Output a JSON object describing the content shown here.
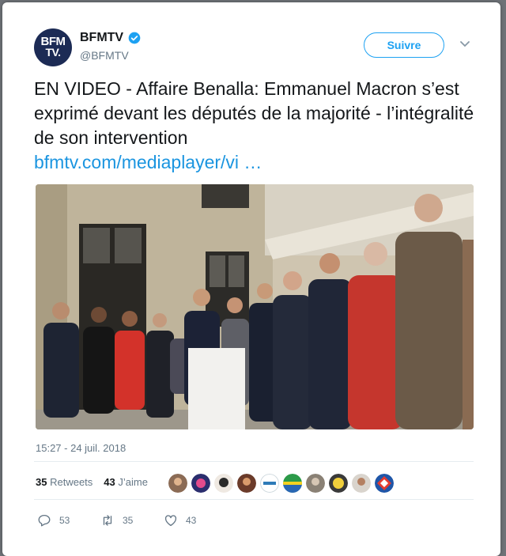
{
  "account": {
    "avatar_line1": "BFM",
    "avatar_line2": "TV.",
    "name": "BFMTV",
    "handle": "@BFMTV",
    "verified": true
  },
  "follow_label": "Suivre",
  "tweet": {
    "text": "EN VIDEO - Affaire Benalla: Emmanuel Macron s’est exprimé devant les députés de la majorité - l’intégralité de son intervention",
    "link": "bfmtv.com/mediaplayer/vi …"
  },
  "timestamp": "15:27 - 24 juil. 2018",
  "stats": {
    "retweets_count": "35",
    "retweets_label": "Retweets",
    "likes_count": "43",
    "likes_label": "J’aime"
  },
  "likers_overflow_icon": "liker-avatar",
  "actions": {
    "replies": "53",
    "retweets": "35",
    "likes": "43"
  },
  "colors": {
    "accent": "#1da1f2",
    "link": "#1b95e0",
    "text": "#14171a",
    "muted": "#657786"
  }
}
